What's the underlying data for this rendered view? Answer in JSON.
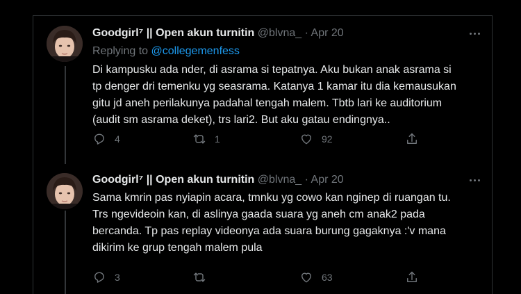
{
  "tweets": [
    {
      "display_name": "Goodgirl⁷ || Open akun turnitin",
      "handle": "@blvna_",
      "separator": "·",
      "date": "Apr 20",
      "replying_prefix": "Replying to",
      "replying_to": "@collegemenfess",
      "text": "Di kampusku ada nder, di asrama si tepatnya. Aku bukan anak asrama si\ntp denger dri temenku yg seasrama. Katanya 1 kamar itu dia kemausukan\ngitu jd aneh perilakunya padahal tengah malem. Tbtb lari ke auditorium\n(audit sm asrama deket), trs lari2. But aku gatau endingnya..",
      "replies": "4",
      "retweets": "1",
      "likes": "92"
    },
    {
      "display_name": "Goodgirl⁷ || Open akun turnitin",
      "handle": "@blvna_",
      "separator": "·",
      "date": "Apr 20",
      "text": "Sama kmrin pas nyiapin acara, tmnku yg cowo kan nginep di ruangan tu.\nTrs ngevideoin kan, di aslinya gaada suara yg aneh cm anak2 pada\nbercanda. Tp pas replay videonya ada suara burung gagaknya :'v mana\ndikirim ke grup tengah malem pula",
      "replies": "3",
      "retweets": "",
      "likes": "63"
    }
  ],
  "colors": {
    "background": "#000000",
    "text": "#e7e9ea",
    "muted": "#71767b",
    "link": "#1d9bf0"
  },
  "icons": [
    "avatar-image",
    "more-icon",
    "reply-icon",
    "retweet-icon",
    "like-icon",
    "share-icon"
  ]
}
